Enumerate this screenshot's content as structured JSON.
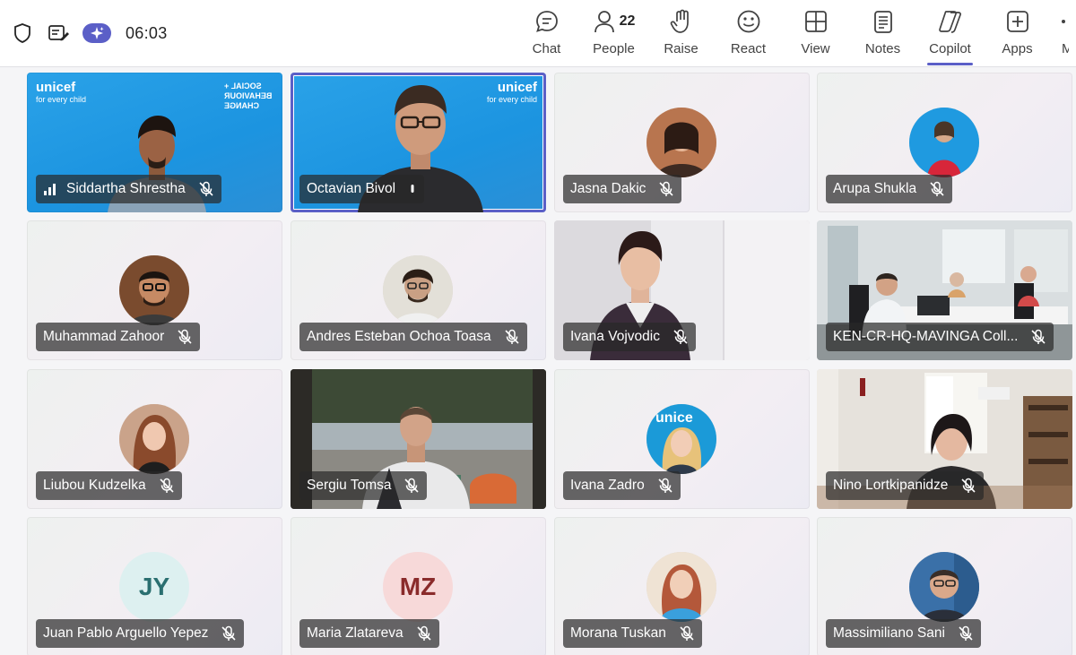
{
  "meeting": {
    "timer": "06:03"
  },
  "toolbar": [
    {
      "key": "chat",
      "label": "Chat"
    },
    {
      "key": "people",
      "label": "People",
      "count": "22"
    },
    {
      "key": "raise",
      "label": "Raise"
    },
    {
      "key": "react",
      "label": "React"
    },
    {
      "key": "view",
      "label": "View"
    },
    {
      "key": "notes",
      "label": "Notes"
    },
    {
      "key": "copilot",
      "label": "Copilot",
      "active": true
    },
    {
      "key": "apps",
      "label": "Apps"
    },
    {
      "key": "more",
      "label": "M"
    }
  ],
  "participants": [
    {
      "name": "Siddartha Shrestha",
      "type": "video",
      "bg": "video-blue",
      "speaking": false,
      "signal": true
    },
    {
      "name": "Octavian Bivol",
      "type": "video",
      "bg": "video-blue",
      "speaking": true,
      "mic_on": true
    },
    {
      "name": "Jasna Dakic",
      "type": "photo",
      "avatar_color": "#6b4a3a"
    },
    {
      "name": "Arupa Shukla",
      "type": "photo",
      "avatar_color": "#1f9ae0"
    },
    {
      "name": "Muhammad Zahoor",
      "type": "photo",
      "avatar_color": "#3d2f2a"
    },
    {
      "name": "Andres Esteban Ochoa Toasa",
      "type": "photo",
      "avatar_color": "#6e6a60"
    },
    {
      "name": "Ivana Vojvodic",
      "type": "video",
      "bg": "office"
    },
    {
      "name": "KEN-CR-HQ-MAVINGA Coll...",
      "type": "video",
      "bg": "office"
    },
    {
      "name": "Liubou Kudzelka",
      "type": "photo",
      "avatar_color": "#7a4a38"
    },
    {
      "name": "Sergiu Tomsa",
      "type": "video",
      "bg": "terrace"
    },
    {
      "name": "Ivana Zadro",
      "type": "photo",
      "avatar_color": "#1b9ad8"
    },
    {
      "name": "Nino Lortkipanidze",
      "type": "video",
      "bg": "room"
    },
    {
      "name": "Juan Pablo Arguello Yepez",
      "type": "initials",
      "initials": "JY",
      "avatar_bg": "#ddf0f0",
      "avatar_fg": "#2a6f70"
    },
    {
      "name": "Maria Zlatareva",
      "type": "initials",
      "initials": "MZ",
      "avatar_bg": "#f7d9d9",
      "avatar_fg": "#8a2b2b"
    },
    {
      "name": "Morana Tuskan",
      "type": "photo",
      "avatar_color": "#5aa8d8"
    },
    {
      "name": "Massimiliano Sani",
      "type": "photo",
      "avatar_color": "#3a70a8"
    }
  ],
  "branding": {
    "unicef_word": "unicef",
    "unicef_tagline": "for every child",
    "sbc_line1": "SOCIAL +",
    "sbc_line2": "BEHAVIOUR",
    "sbc_line3": "CHANGE",
    "zadro_text": "unice"
  },
  "colors": {
    "accent": "#5b5fc7",
    "tile_blue": "#1c94e0"
  }
}
